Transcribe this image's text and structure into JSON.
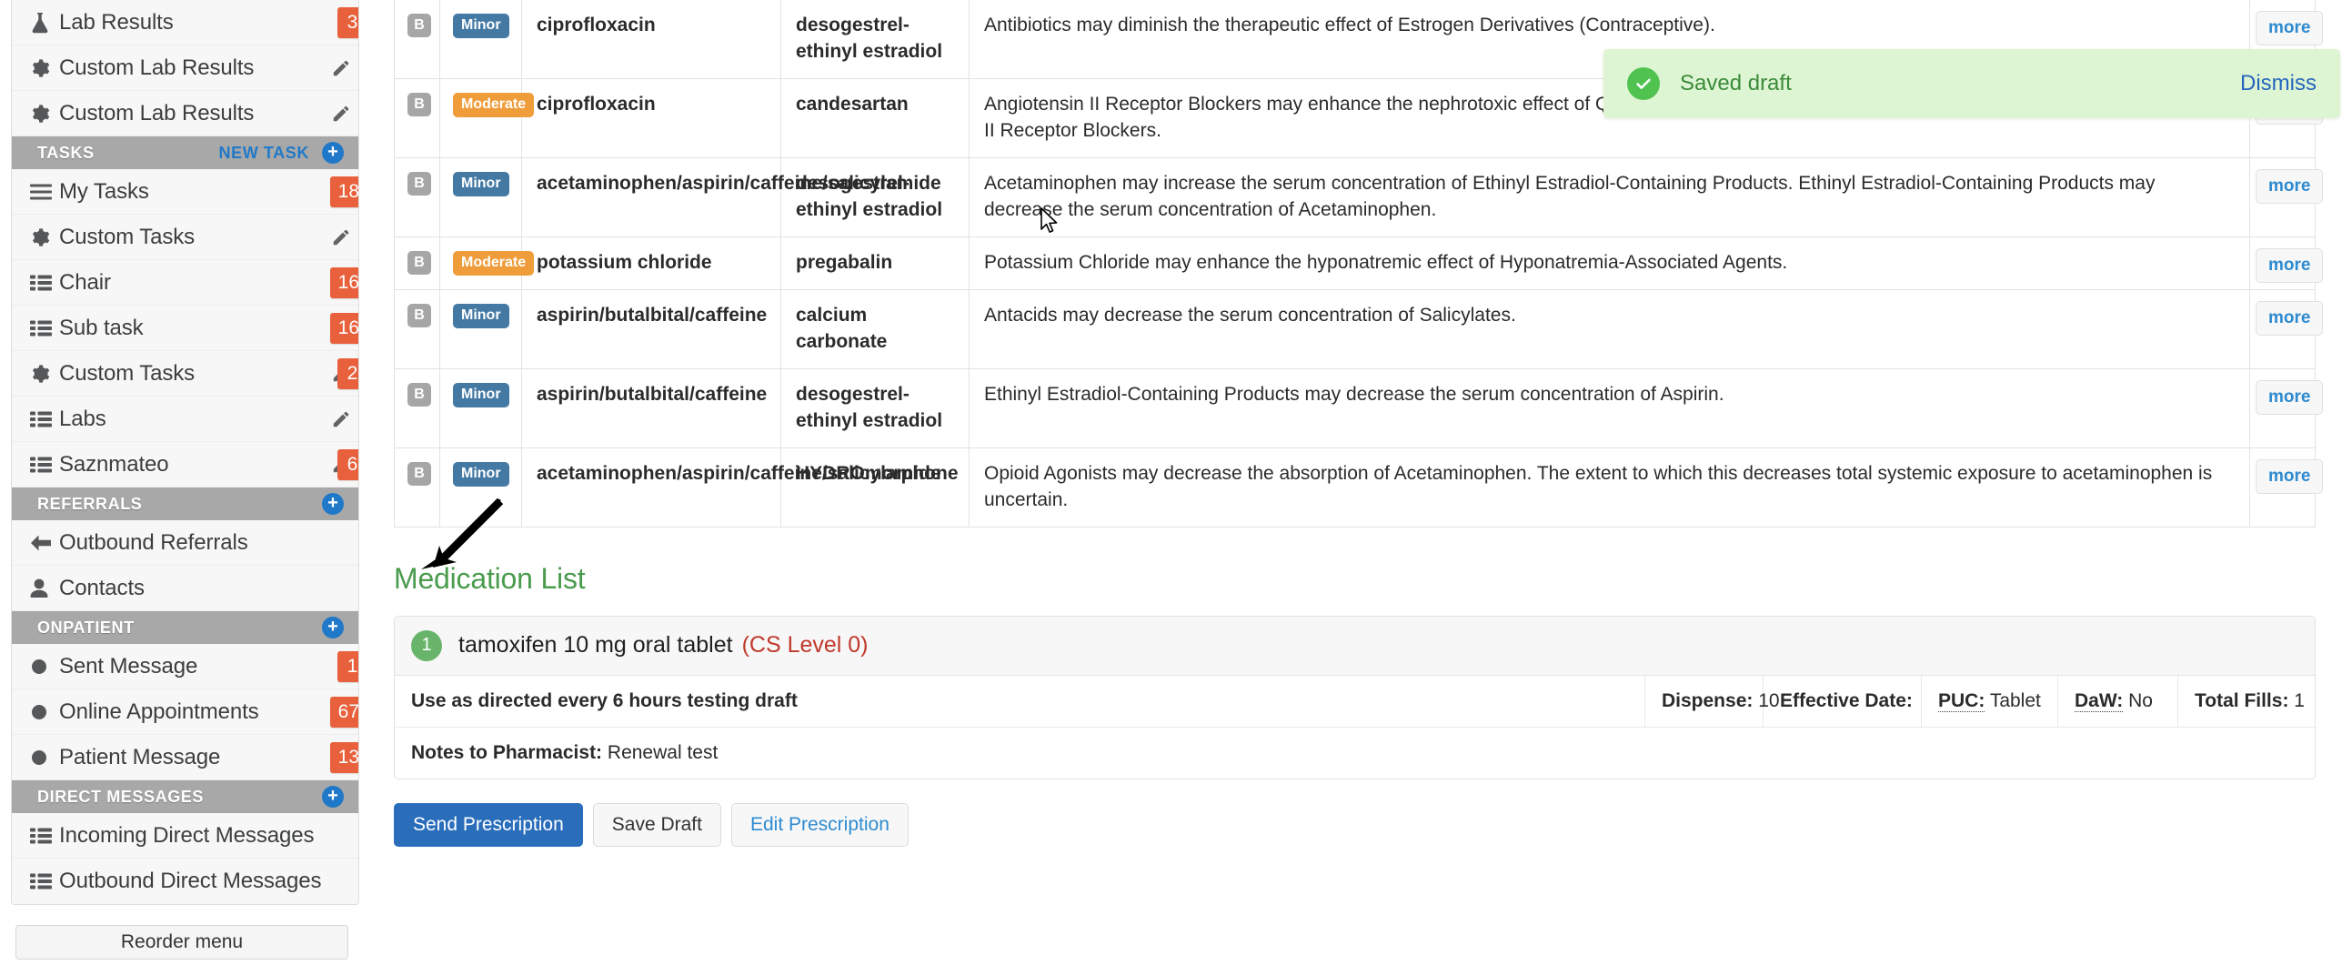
{
  "sidebar": {
    "items": [
      {
        "label": "Lab Results",
        "icon": "flask-icon",
        "pencil": false,
        "badge": "3"
      },
      {
        "label": "Custom Lab Results",
        "icon": "gear-icon",
        "pencil": true,
        "badge": ""
      },
      {
        "label": "Custom Lab Results",
        "icon": "gear-icon",
        "pencil": true,
        "badge": ""
      }
    ],
    "sections": [
      {
        "title": "TASKS",
        "action": "NEW TASK",
        "items": [
          {
            "label": "My Tasks",
            "icon": "list-lines-icon",
            "pencil": false,
            "badge": "18"
          },
          {
            "label": "Custom Tasks",
            "icon": "gear-icon",
            "pencil": true,
            "badge": ""
          },
          {
            "label": "Chair",
            "icon": "list-bullets-icon",
            "pencil": true,
            "badge": "16"
          },
          {
            "label": "Sub task",
            "icon": "list-bullets-icon",
            "pencil": true,
            "badge": "16"
          },
          {
            "label": "Custom Tasks",
            "icon": "gear-icon",
            "pencil": true,
            "badge": "2"
          },
          {
            "label": "Labs",
            "icon": "list-bullets-icon",
            "pencil": true,
            "badge": ""
          },
          {
            "label": "Saznmateo",
            "icon": "list-bullets-icon",
            "pencil": true,
            "badge": "6"
          }
        ]
      },
      {
        "title": "REFERRALS",
        "action": "",
        "items": [
          {
            "label": "Outbound Referrals",
            "icon": "arrow-left-icon",
            "pencil": false,
            "badge": ""
          },
          {
            "label": "Contacts",
            "icon": "person-icon",
            "pencil": false,
            "badge": ""
          }
        ]
      },
      {
        "title": "ONPATIENT",
        "action": "",
        "items": [
          {
            "label": "Sent Message",
            "icon": "circle-dot-icon",
            "pencil": false,
            "badge": "1"
          },
          {
            "label": "Online Appointments",
            "icon": "circle-dot-icon",
            "pencil": false,
            "badge": "67"
          },
          {
            "label": "Patient Message",
            "icon": "circle-dot-icon",
            "pencil": false,
            "badge": "13"
          }
        ]
      },
      {
        "title": "DIRECT MESSAGES",
        "action": "",
        "items": [
          {
            "label": "Incoming Direct Messages",
            "icon": "list-bullets-icon",
            "pencil": false,
            "badge": ""
          },
          {
            "label": "Outbound Direct Messages",
            "icon": "list-bullets-icon",
            "pencil": false,
            "badge": ""
          }
        ]
      }
    ],
    "reorder_label": "Reorder menu"
  },
  "interactions": {
    "more_label": "more",
    "rows": [
      {
        "flag": "B",
        "severity": "Minor",
        "drug1": "ciprofloxacin",
        "drug2": "desogestrel-ethinyl estradiol",
        "description": "Antibiotics may diminish the therapeutic effect of Estrogen Derivatives (Contraceptive)."
      },
      {
        "flag": "B",
        "severity": "Moderate",
        "drug1": "ciprofloxacin",
        "drug2": "candesartan",
        "description": "Angiotensin II Receptor Blockers may enhance the nephrotoxic effect of Quinolones. Quinolones may enhance the nephrotoxic effect of Angiotensin II Receptor Blockers."
      },
      {
        "flag": "B",
        "severity": "Minor",
        "drug1": "acetaminophen/aspirin/caffeine/salicylamide",
        "drug2": "desogestrel-ethinyl estradiol",
        "description": "Acetaminophen may increase the serum concentration of Ethinyl Estradiol-Containing Products. Ethinyl Estradiol-Containing Products may decrease the serum concentration of Acetaminophen."
      },
      {
        "flag": "B",
        "severity": "Moderate",
        "drug1": "potassium chloride",
        "drug2": "pregabalin",
        "description": "Potassium Chloride may enhance the hyponatremic effect of Hyponatremia-Associated Agents."
      },
      {
        "flag": "B",
        "severity": "Minor",
        "drug1": "aspirin/butalbital/caffeine",
        "drug2": "calcium carbonate",
        "description": "Antacids may decrease the serum concentration of Salicylates."
      },
      {
        "flag": "B",
        "severity": "Minor",
        "drug1": "aspirin/butalbital/caffeine",
        "drug2": "desogestrel-ethinyl estradiol",
        "description": "Ethinyl Estradiol-Containing Products may decrease the serum concentration of Aspirin."
      },
      {
        "flag": "B",
        "severity": "Minor",
        "drug1": "acetaminophen/aspirin/caffeine/salicylamide",
        "drug2": "HYDROmorphone",
        "description": "Opioid Agonists may decrease the absorption of Acetaminophen. The extent to which this decreases total systemic exposure to acetaminophen is uncertain."
      }
    ]
  },
  "medication_list": {
    "title": "Medication List",
    "entry": {
      "number": "1",
      "name": "tamoxifen 10 mg oral tablet",
      "cs_level": "(CS Level 0)",
      "sig": "Use as directed every 6 hours testing draft",
      "dispense_label": "Dispense:",
      "dispense_value": "10",
      "effective_date_label": "Effective Date:",
      "effective_date_value": "",
      "puc_label": "PUC:",
      "puc_value": "Tablet",
      "daw_label": "DaW:",
      "daw_value": "No",
      "total_fills_label": "Total Fills:",
      "total_fills_value": "1",
      "notes_label": "Notes to Pharmacist:",
      "notes_value": "Renewal test"
    },
    "actions": {
      "send": "Send Prescription",
      "save_draft": "Save Draft",
      "edit": "Edit Prescription"
    }
  },
  "toast": {
    "message": "Saved draft",
    "dismiss": "Dismiss",
    "bg_color": "#ddf5d2",
    "icon_color": "#4fc24f",
    "text_color": "#3b8b3b"
  }
}
